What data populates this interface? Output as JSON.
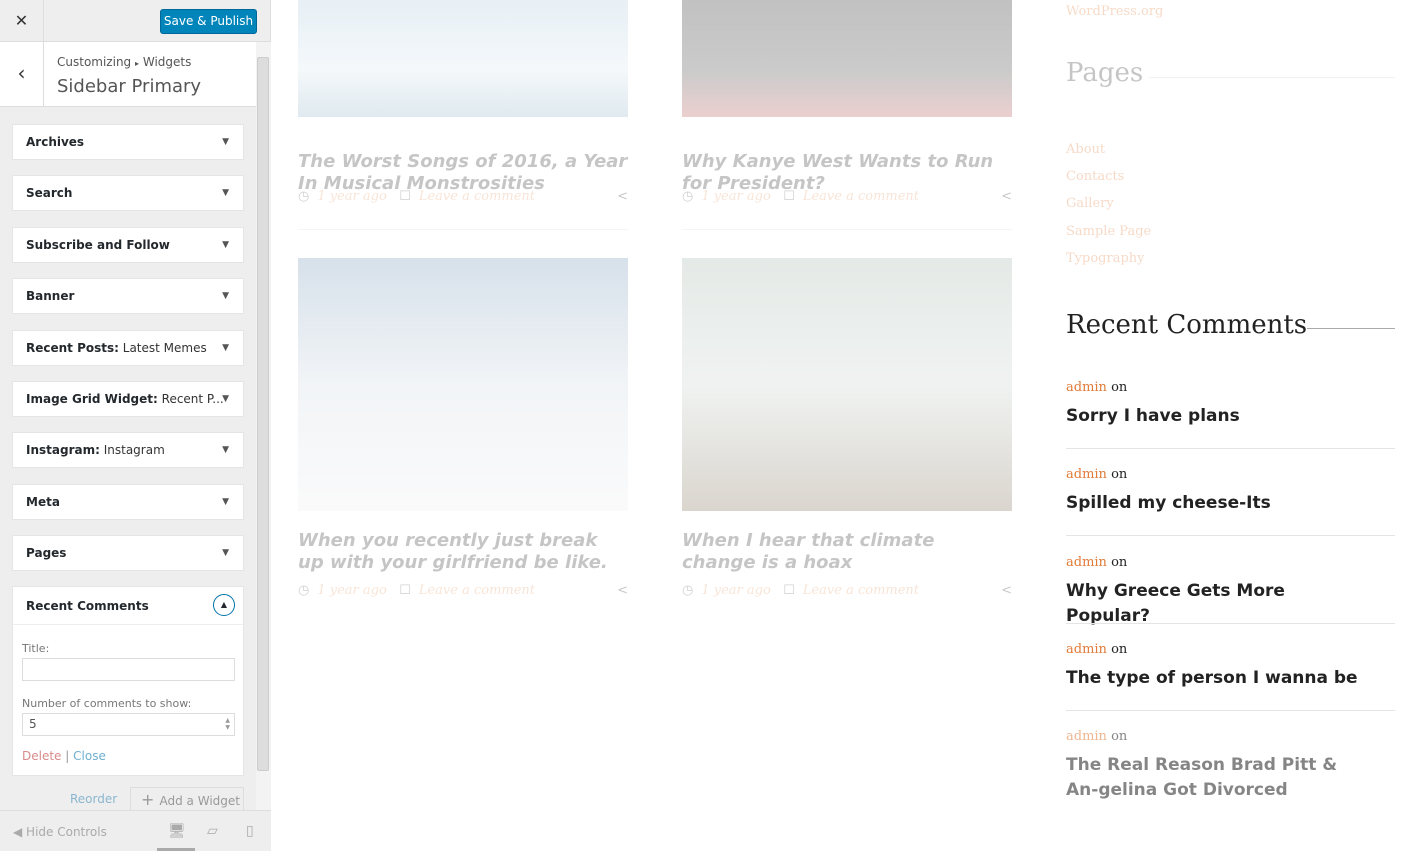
{
  "panel": {
    "close_icon": "close-icon",
    "publish": "Save & Publish",
    "breadcrumb_root": "Customizing",
    "breadcrumb_sep": "▸",
    "breadcrumb_section": "Widgets",
    "title": "Sidebar Primary",
    "widgets": [
      {
        "name": "Archives",
        "sub": ""
      },
      {
        "name": "Search",
        "sub": ""
      },
      {
        "name": "Subscribe and Follow",
        "sub": ""
      },
      {
        "name": "Banner",
        "sub": ""
      },
      {
        "name": "Recent Posts:",
        "sub": " Latest Memes"
      },
      {
        "name": "Image Grid Widget:",
        "sub": " Recent P..."
      },
      {
        "name": "Instagram:",
        "sub": " Instagram"
      },
      {
        "name": "Meta",
        "sub": ""
      },
      {
        "name": "Pages",
        "sub": ""
      }
    ],
    "expanded": {
      "name": "Recent Comments",
      "title_label": "Title:",
      "title_value": "",
      "count_label": "Number of comments to show:",
      "count_value": "5",
      "delete": "Delete",
      "sep": "|",
      "close": "Close"
    },
    "reorder": "Reorder",
    "add_widget": "Add a Widget",
    "hide_controls": "Hide Controls"
  },
  "posts": [
    {
      "title": "The Worst Songs of 2016, a Year In Musical Monstrosities",
      "time": "1 year ago",
      "comment": "Leave a comment"
    },
    {
      "title": "Why Kanye West Wants to Run for President?",
      "time": "1 year ago",
      "comment": "Leave a comment"
    },
    {
      "title": "When you recently just break up with your girlfriend be like.",
      "time": "1 year ago",
      "comment": "Leave a comment"
    },
    {
      "title": "When I hear that climate change is a hoax",
      "time": "1 year ago",
      "comment": "Leave a comment"
    }
  ],
  "sidebar": {
    "wp_link": "WordPress.org",
    "pages_heading": "Pages",
    "pages": [
      "About",
      "Contacts",
      "Gallery",
      "Sample Page",
      "Typography"
    ],
    "recent_heading": "Recent Comments",
    "comments": [
      {
        "author": "admin",
        "on": "on",
        "title": "Sorry I have plans"
      },
      {
        "author": "admin",
        "on": "on",
        "title": "Spilled my cheese-Its"
      },
      {
        "author": "admin",
        "on": "on",
        "title": "Why Greece Gets More Popular?"
      },
      {
        "author": "admin",
        "on": "on",
        "title": "The type of person I wanna be"
      },
      {
        "author": "admin",
        "on": "on",
        "title": "The Real Reason Brad Pitt & An-gelina Got Divorced"
      }
    ]
  },
  "colors": {
    "accent": "#0085ba",
    "link": "#e07b39"
  }
}
